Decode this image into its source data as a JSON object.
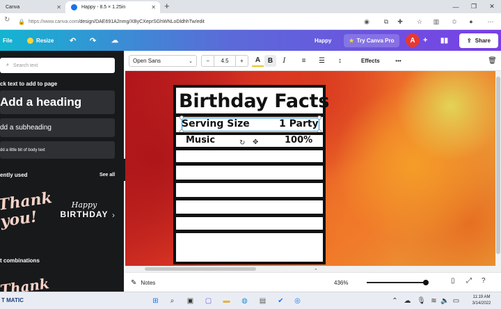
{
  "browser": {
    "tabs": [
      {
        "label": "Canva",
        "active": false
      },
      {
        "label": "Happy - 8.5 × 1.25in",
        "active": true
      }
    ],
    "url_host": "https://www.canva.com",
    "url_path": "/design/DAE691A2nmg/XByCXeprSGhWNLoDldhhTw/edit",
    "new_tab_symbol": "+"
  },
  "header": {
    "file_label": "File",
    "resize_label": "Resize",
    "doc_title": "Happy",
    "try_pro_label": "Try Canva Pro",
    "avatar_letter": "A",
    "share_label": "Share",
    "gradient": [
      "#13b5d1",
      "#7a3fe6"
    ]
  },
  "sidebar": {
    "search_placeholder": "Search text",
    "click_to_add": "ck text to add to page",
    "add_heading": "Add a heading",
    "add_subheading": "dd a subheading",
    "add_body": "dd a little bit of body text",
    "recently_used": "ently used",
    "see_all": "See all",
    "thank_you": "Thank you!",
    "happy": "Happy",
    "birthday": "BIRTHDAY",
    "font_combinations": "t combinations",
    "thank_partial": "Thank"
  },
  "toolbar": {
    "font_name": "Open Sans",
    "font_size": "4.5",
    "minus": "−",
    "plus": "+",
    "color_glyph": "A",
    "bold_glyph": "B",
    "italic_glyph": "I",
    "effects_label": "Effects",
    "more_glyph": "•••"
  },
  "design": {
    "title": "Birthday Facts",
    "rows": [
      {
        "label": "Serving Size",
        "value": "1 Party",
        "selected": true
      },
      {
        "label": "Music",
        "value": "100%",
        "selected": false
      }
    ],
    "empty_rows": 6
  },
  "bottom": {
    "notes_label": "Notes",
    "zoom_label": "436%",
    "zoom_fraction": 0.95
  },
  "taskbar": {
    "left_label": "T MATIC",
    "time": "11:19 AM",
    "date": "3/14/2022"
  }
}
